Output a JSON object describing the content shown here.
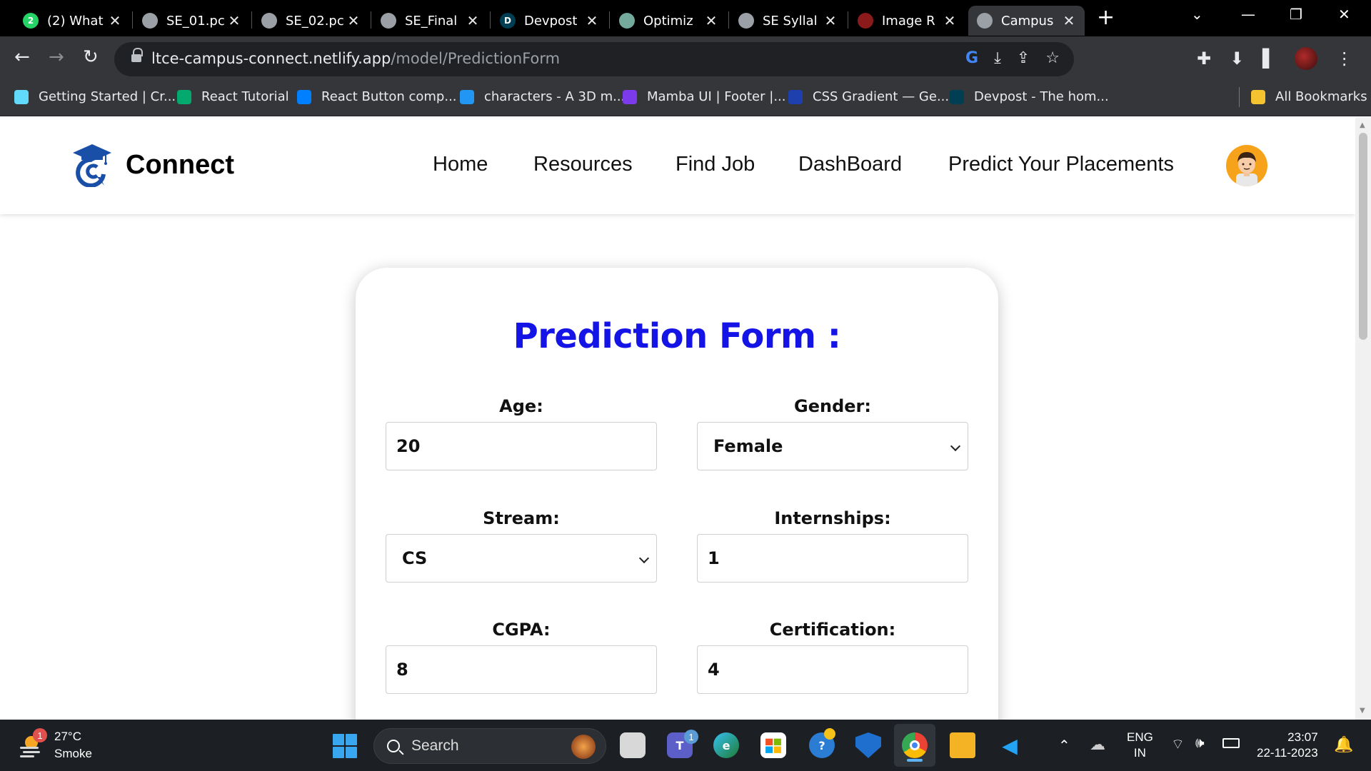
{
  "browser": {
    "tabs": [
      {
        "label": "(2) What",
        "icon": "whatsapp-icon",
        "color": "#25d366",
        "glyph": "2"
      },
      {
        "label": "SE_01.pc",
        "icon": "globe-icon",
        "color": "#9aa0a6",
        "glyph": ""
      },
      {
        "label": "SE_02.pc",
        "icon": "globe-icon",
        "color": "#9aa0a6",
        "glyph": ""
      },
      {
        "label": "SE_Final",
        "icon": "globe-icon",
        "color": "#9aa0a6",
        "glyph": ""
      },
      {
        "label": "Devpost",
        "icon": "devpost-icon",
        "color": "#003e54",
        "glyph": "D"
      },
      {
        "label": "Optimiz",
        "icon": "chatgpt-icon",
        "color": "#74aa9c",
        "glyph": ""
      },
      {
        "label": "SE Syllal",
        "icon": "globe-icon",
        "color": "#9aa0a6",
        "glyph": ""
      },
      {
        "label": "Image R",
        "icon": "image-site-icon",
        "color": "#8b1a1a",
        "glyph": ""
      },
      {
        "label": "Campus",
        "icon": "globe-icon",
        "color": "#9aa0a6",
        "glyph": ""
      }
    ],
    "active_tab": 8,
    "url_host": "ltce-campus-connect.netlify.app",
    "url_path": "/model/PredictionForm",
    "bookmarks": [
      {
        "label": "Getting Started | Cr...",
        "icon": "react-icon",
        "color": "#61dafb"
      },
      {
        "label": "React Tutorial",
        "icon": "w3schools-icon",
        "color": "#04aa6d"
      },
      {
        "label": "React Button comp...",
        "icon": "mui-icon",
        "color": "#007fff"
      },
      {
        "label": "characters - A 3D m...",
        "icon": "3d-cube-icon",
        "color": "#2196f3"
      },
      {
        "label": "Mamba UI | Footer |...",
        "icon": "mamba-icon",
        "color": "#7c3aed"
      },
      {
        "label": "CSS Gradient — Ge...",
        "icon": "gradient-icon",
        "color": "#1e40af"
      },
      {
        "label": "Devpost - The hom...",
        "icon": "devpost-icon",
        "color": "#003e54"
      }
    ],
    "all_bookmarks": "All Bookmarks"
  },
  "site": {
    "brand": "Connect",
    "nav": [
      "Home",
      "Resources",
      "Find Job",
      "DashBoard",
      "Predict Your Placements"
    ]
  },
  "form": {
    "title": "Prediction Form :",
    "fields": {
      "age": {
        "label": "Age:",
        "value": "20"
      },
      "gender": {
        "label": "Gender:",
        "value": "Female"
      },
      "stream": {
        "label": "Stream:",
        "value": "CS"
      },
      "internships": {
        "label": "Internships:",
        "value": "1"
      },
      "cgpa": {
        "label": "CGPA:",
        "value": "8"
      },
      "certification": {
        "label": "Certification:",
        "value": "4"
      }
    }
  },
  "taskbar": {
    "weather_temp": "27°C",
    "weather_desc": "Smoke",
    "weather_badge": "1",
    "search_placeholder": "Search",
    "teams_badge": "1",
    "lang_top": "ENG",
    "lang_bottom": "IN",
    "time": "23:07",
    "date": "22-11-2023"
  },
  "colors": {
    "form_title": "#1414e6",
    "brand_blue": "#1a4fa8",
    "avatar_bg": "#f7a21b"
  }
}
